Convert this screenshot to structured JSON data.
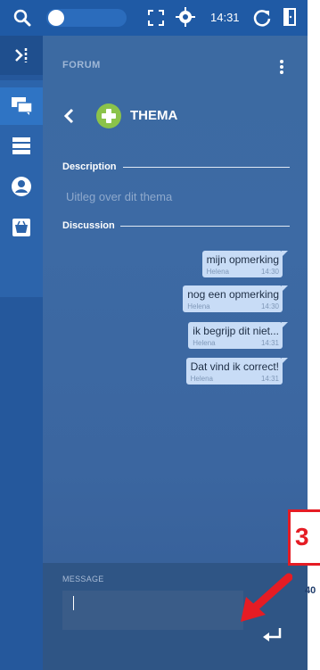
{
  "topbar": {
    "time": "14:31",
    "icons": [
      "search-icon",
      "toggle-switch",
      "expand-icon",
      "crosshair-icon",
      "refresh-icon",
      "exit-door-icon"
    ]
  },
  "sidebar": {
    "items": [
      {
        "name": "collapse-icon"
      },
      {
        "name": "forum-chat-icon"
      },
      {
        "name": "stack-icon"
      },
      {
        "name": "person-icon"
      },
      {
        "name": "basket-icon"
      }
    ]
  },
  "header": {
    "section": "FORUM",
    "title": "THEMA"
  },
  "description": {
    "label": "Description",
    "text": "Uitleg over dit thema"
  },
  "discussion": {
    "label": "Discussion",
    "messages": [
      {
        "text": "mijn opmerking",
        "author": "Helena",
        "time": "14:30"
      },
      {
        "text": "nog een opmerking",
        "author": "Helena",
        "time": "14:30"
      },
      {
        "text": "ik begrijp dit niet...",
        "author": "Helena",
        "time": "14:31"
      },
      {
        "text": "Dat vind ik correct!",
        "author": "Helena",
        "time": "14:31"
      }
    ]
  },
  "composer": {
    "label": "MESSAGE",
    "value": ""
  },
  "annotation": {
    "number": "3",
    "side_text": "40"
  },
  "colors": {
    "topbar": "#1f5aa5",
    "accent_green": "#8bc34a",
    "bubble": "#c8dcf6",
    "annotation_red": "#e51c24"
  }
}
